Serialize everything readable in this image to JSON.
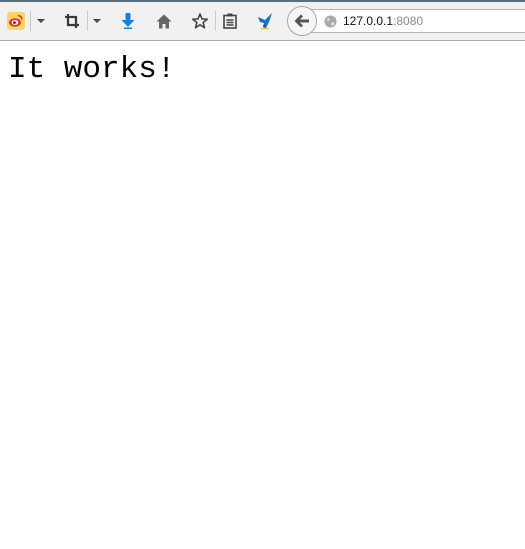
{
  "toolbar": {
    "buttons": [
      {
        "name": "weibo",
        "icon": "weibo-icon"
      },
      {
        "name": "weibo-menu",
        "icon": "chevron-down-icon"
      },
      {
        "name": "screenshot",
        "icon": "crop-icon"
      },
      {
        "name": "screenshot-menu",
        "icon": "chevron-down-icon"
      },
      {
        "name": "downloads",
        "icon": "download-arrow-icon"
      },
      {
        "name": "home",
        "icon": "home-icon"
      },
      {
        "name": "bookmark",
        "icon": "star-icon"
      },
      {
        "name": "reading-list",
        "icon": "clipboard-icon"
      },
      {
        "name": "bird-extension",
        "icon": "bird-icon"
      },
      {
        "name": "back",
        "icon": "back-arrow-icon"
      }
    ],
    "colors": {
      "download": "#1e7fd8",
      "weibo": "#e8302a"
    }
  },
  "address_bar": {
    "host": "127.0.0.1",
    "port": ":8080"
  },
  "page": {
    "heading": "It works!"
  }
}
